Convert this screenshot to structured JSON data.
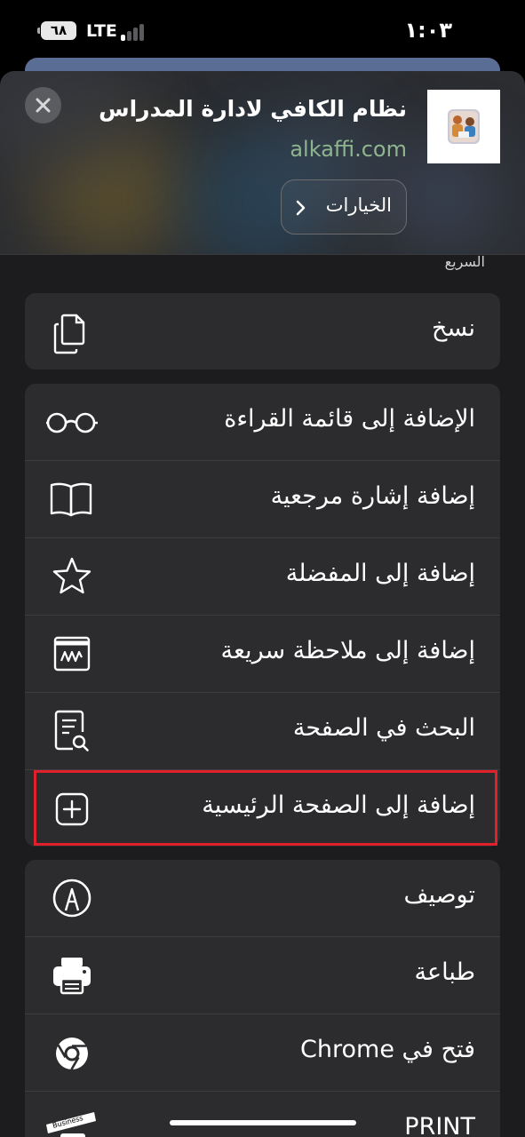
{
  "status_bar": {
    "battery": "٦٨",
    "network": "LTE",
    "time": "١:٠٣"
  },
  "header": {
    "close_icon": "close-icon",
    "app_icon": "school-app-icon",
    "title": "نظام الكافي لادارة المدراس",
    "domain": "alkaffi.com",
    "options_label": "الخيارات",
    "options_icon": "chevron-right-icon"
  },
  "partial_label": "السريع",
  "groups": [
    {
      "items": [
        {
          "label": "نسخ",
          "icon": "copy-icon"
        }
      ]
    },
    {
      "items": [
        {
          "label": "الإضافة إلى قائمة القراءة",
          "icon": "reading-glasses-icon"
        },
        {
          "label": "إضافة إشارة مرجعية",
          "icon": "book-icon"
        },
        {
          "label": "إضافة إلى المفضلة",
          "icon": "star-icon"
        },
        {
          "label": "إضافة إلى ملاحظة سريعة",
          "icon": "quick-note-icon"
        },
        {
          "label": "البحث في الصفحة",
          "icon": "find-in-page-icon"
        },
        {
          "label": "إضافة إلى الصفحة الرئيسية",
          "icon": "plus-square-icon"
        }
      ]
    },
    {
      "items": [
        {
          "label": "توصيف",
          "icon": "markup-pen-icon"
        },
        {
          "label": "طباعة",
          "icon": "printer-icon"
        },
        {
          "label": "فتح في Chrome",
          "icon": "chrome-icon"
        },
        {
          "label": "PRINT",
          "icon": "business-print-icon"
        }
      ]
    }
  ],
  "colors": {
    "sheet_bg": "#1c1c1e",
    "group_bg": "#2c2c2e",
    "highlight": "#e0202a",
    "domain_text": "#8fb58f"
  }
}
